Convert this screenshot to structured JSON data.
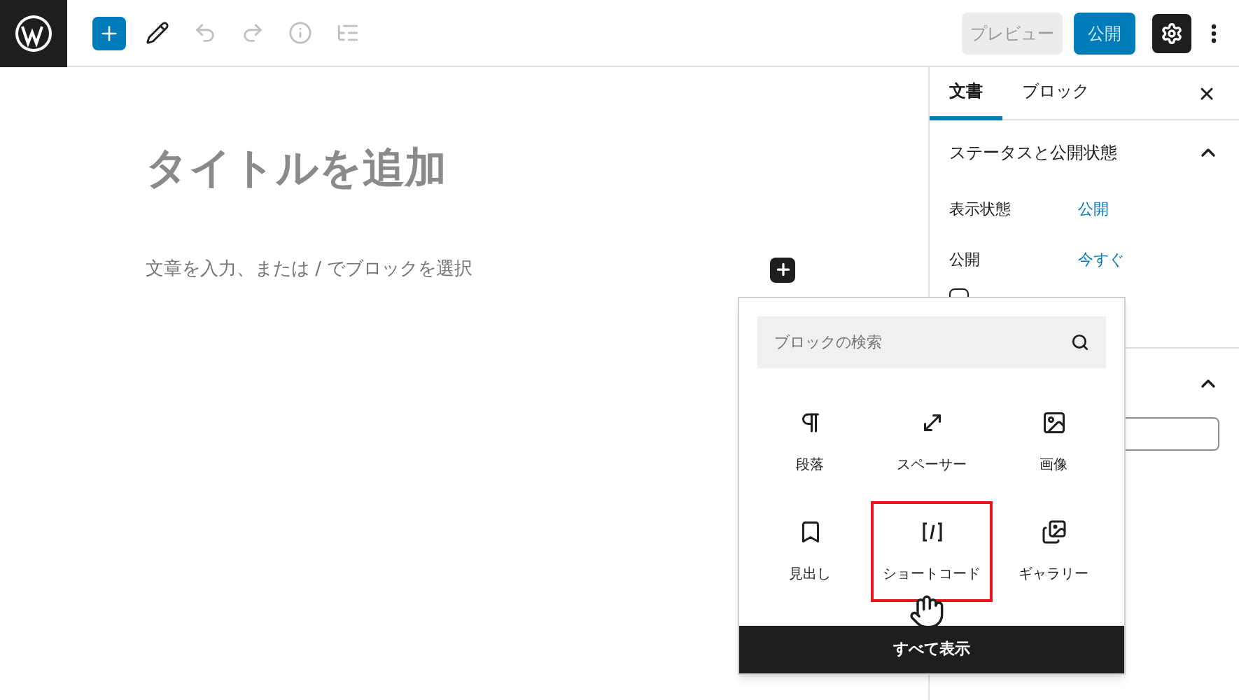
{
  "toolbar": {
    "buttons": [
      {
        "kind": "add",
        "disabled": false
      },
      {
        "kind": "edit",
        "disabled": false
      },
      {
        "kind": "undo",
        "disabled": true
      },
      {
        "kind": "redo",
        "disabled": true
      },
      {
        "kind": "info",
        "disabled": true
      },
      {
        "kind": "outline",
        "disabled": true
      }
    ],
    "preview": "プレビュー",
    "publish": "公開",
    "settings_on": true
  },
  "editor": {
    "title_placeholder": "タイトルを追加",
    "body_placeholder": "文章を入力、または / でブロックを選択"
  },
  "sidebar": {
    "tabs": [
      {
        "label": "文書",
        "selected": true
      },
      {
        "label": "ブロック",
        "selected": false
      }
    ],
    "section": {
      "title": "ステータスと公開状態",
      "expanded": true,
      "rows": [
        {
          "label": "表示状態",
          "value": "公開"
        },
        {
          "label": "公開",
          "value": "今すぐ"
        }
      ]
    },
    "pending_review": {
      "checked": false
    },
    "section_2": {
      "expanded": true
    }
  },
  "inserter": {
    "search_placeholder": "ブロックの検索",
    "blocks": [
      {
        "kind": "paragraph",
        "label": "段落",
        "highlighted": false
      },
      {
        "kind": "spacer",
        "label": "スペーサー",
        "highlighted": false
      },
      {
        "kind": "image",
        "label": "画像",
        "highlighted": false
      },
      {
        "kind": "heading",
        "label": "見出し",
        "highlighted": false
      },
      {
        "kind": "shortcode",
        "label": "ショートコード",
        "highlighted": true
      },
      {
        "kind": "gallery",
        "label": "ギャラリー",
        "highlighted": false
      }
    ],
    "show_all": "すべて表示"
  }
}
